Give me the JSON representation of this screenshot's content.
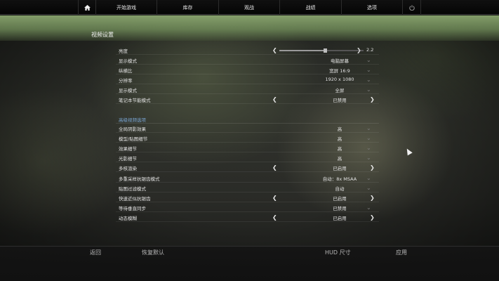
{
  "nav": {
    "items": [
      "开始游戏",
      "库存",
      "观战",
      "战绩",
      "选项"
    ]
  },
  "page": {
    "title": "视频设置"
  },
  "brightness": {
    "label": "亮度",
    "value": "2.2",
    "slider_fraction": 0.54
  },
  "basic_rows": [
    {
      "label": "显示模式",
      "value": "电脑屏幕",
      "control": "dropdown"
    },
    {
      "label": "纵横比",
      "value": "宽屏 16:9",
      "control": "dropdown"
    },
    {
      "label": "分辨率",
      "value": "1920 x 1080",
      "control": "dropdown"
    },
    {
      "label": "显示模式",
      "value": "全屏",
      "control": "dropdown"
    },
    {
      "label": "笔记本节能模式",
      "value": "已禁用",
      "control": "arrows"
    }
  ],
  "advanced": {
    "section_title": "高级视频选项",
    "rows": [
      {
        "label": "全局阴影效果",
        "value": "高",
        "control": "dropdown"
      },
      {
        "label": "模型/贴图细节",
        "value": "高",
        "control": "dropdown"
      },
      {
        "label": "效果细节",
        "value": "高",
        "control": "dropdown"
      },
      {
        "label": "光影细节",
        "value": "高",
        "control": "dropdown"
      },
      {
        "label": "多核渲染",
        "value": "已启用",
        "control": "arrows"
      },
      {
        "label": "多重采样抗锯齿模式",
        "value": "自动：8x MSAA",
        "control": "dropdown"
      },
      {
        "label": "贴图过滤模式",
        "value": "自动",
        "control": "dropdown"
      },
      {
        "label": "快速近似抗锯齿",
        "value": "已启用",
        "control": "arrows"
      },
      {
        "label": "等待垂直同步",
        "value": "已禁用",
        "control": "dropdown"
      },
      {
        "label": "动态模糊",
        "value": "已启用",
        "control": "arrows"
      }
    ]
  },
  "bottom": {
    "back": "返回",
    "reset": "恢复默认",
    "hud": "HUD 尺寸",
    "apply": "应用"
  },
  "glyphs": {
    "left": "❮",
    "right": "❯",
    "dropdown": "⌄"
  }
}
